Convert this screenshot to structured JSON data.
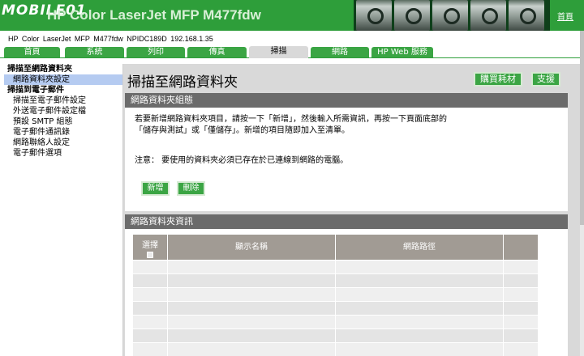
{
  "banner": {
    "logo": "MOBILE01",
    "title": "HP Color LaserJet MFP M477fdw",
    "home_link": "首頁"
  },
  "device_line": "HP Color LaserJet MFP M477fdw   NPIDC189D   192.168.1.35",
  "tabs": [
    "首頁",
    "系統",
    "列印",
    "傳真",
    "掃描",
    "網路",
    "HP Web 服務"
  ],
  "active_tab": "掃描",
  "sidebar": {
    "groups": [
      {
        "title": "掃描至網路資料夾",
        "items": [
          "網路資料夾設定"
        ]
      },
      {
        "title": "掃描到電子郵件",
        "items": [
          "掃描至電子郵件設定",
          "外送電子郵件設定檔",
          "預設 SMTP 組態",
          "電子郵件通訊錄",
          "網路聯絡人設定",
          "電子郵件選項"
        ]
      }
    ],
    "selected": "網路資料夾設定"
  },
  "main": {
    "title": "掃描至網路資料夾",
    "buy_supplies": "購買耗材",
    "support": "支援",
    "section1": {
      "header": "網路資料夾組態",
      "line1": "若要新增網路資料夾項目，請按一下「新增」，然後輸入所需資訊，再按一下頁面底部的",
      "line2": "「儲存與測試」或「僅儲存」。新增的項目隨即加入至清單。",
      "note": "注意： 要使用的資料夾必須已存在於已連線到網路的電腦。",
      "add_button": "新增",
      "delete_button": "刪除"
    },
    "section2": {
      "header": "網路資料夾資訊",
      "columns": [
        "選擇",
        "顯示名稱",
        "網路路徑",
        ""
      ]
    }
  },
  "colors": {
    "brand_green": "#3ba544",
    "section_gray": "#6b6b6b",
    "table_header": "#a19b94",
    "selection_blue": "#b5cbf1"
  }
}
